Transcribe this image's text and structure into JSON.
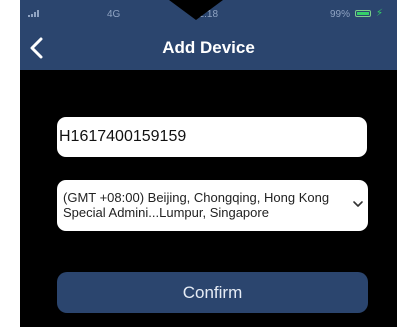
{
  "status_bar": {
    "network": "4G",
    "time": "21:18",
    "battery": "99%",
    "icons": [
      "signal-icon",
      "battery-icon",
      "charge-icon"
    ]
  },
  "header": {
    "title": "Add Device",
    "back_icon": "chevron-left-icon",
    "background_color": "#2b456e"
  },
  "form": {
    "serial_number_value": "H1617400159159",
    "timezone": {
      "selected": "(GMT +08:00) Beijing, Chongqing, Hong Kong Special Admini...Lumpur, Singapore",
      "icon": "chevron-down-icon"
    },
    "confirm_label": "Confirm"
  },
  "colors": {
    "header_bg": "#2b456e",
    "screen_bg": "#000000",
    "button_bg": "#2b456e",
    "battery_green": "#35d069"
  }
}
